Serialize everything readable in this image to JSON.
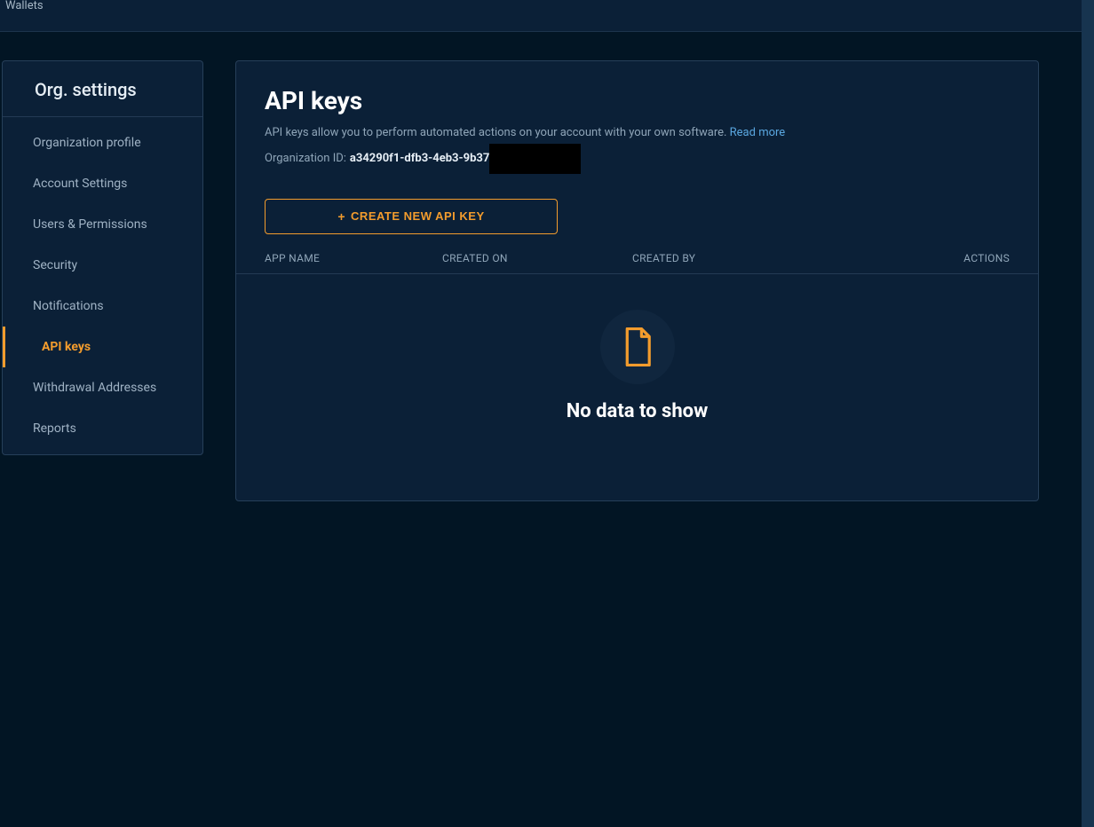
{
  "topbar": {
    "wallets": "Wallets"
  },
  "sidebar": {
    "title": "Org. settings",
    "items": [
      {
        "label": "Organization profile",
        "active": false
      },
      {
        "label": "Account Settings",
        "active": false
      },
      {
        "label": "Users & Permissions",
        "active": false
      },
      {
        "label": "Security",
        "active": false
      },
      {
        "label": "Notifications",
        "active": false
      },
      {
        "label": "API keys",
        "active": true
      },
      {
        "label": "Withdrawal Addresses",
        "active": false
      },
      {
        "label": "Reports",
        "active": false
      }
    ]
  },
  "main": {
    "title": "API keys",
    "description": "API keys allow you to perform automated actions on your account with your own software.",
    "read_more": "Read more",
    "org_id_label": "Organization ID:",
    "org_id_value": "a34290f1-dfb3-4eb3-9b37",
    "create_button": "CREATE NEW API KEY",
    "table_headers": {
      "app_name": "APP NAME",
      "created_on": "CREATED ON",
      "created_by": "CREATED BY",
      "actions": "ACTIONS"
    },
    "empty_state": "No data to show"
  }
}
